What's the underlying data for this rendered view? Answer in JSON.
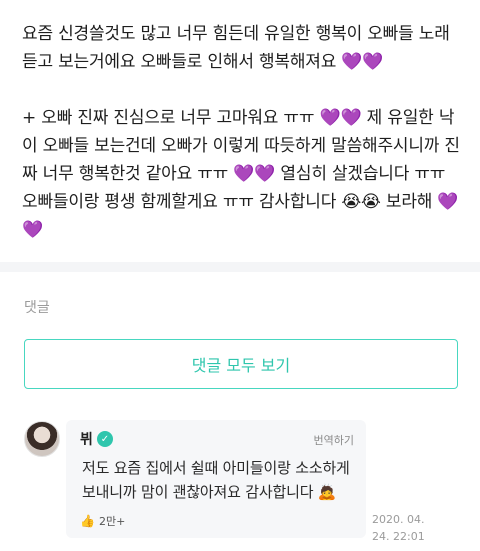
{
  "post": {
    "paragraph1": "요즘 신경쓸것도 많고 너무 힘든데 유일한 행복이 오빠들 노래듣고 보는거에요 오빠들로 인해서 행복해져요 💜💜",
    "paragraph2": "+ 오빠 진짜 진심으로 너무 고마워요 ㅠㅠ 💜💜 제 유일한 낙이 오빠들 보는건데 오빠가 이렇게 따듯하게 말씀해주시니까 진짜 너무 행복한것 같아요 ㅠㅠ 💜💜 열심히 살겠습니다 ㅠㅠ 오빠들이랑 평생 함께할게요 ㅠㅠ 감사합니다 😭😭 보라해 💜💜"
  },
  "comments": {
    "section_label": "댓글",
    "view_all_label": "댓글 모두 보기",
    "items": [
      {
        "author": "뷔",
        "verified_icon": "verified-check-icon",
        "translate_label": "번역하기",
        "text": "저도 요즘 집에서 쉴때 아미들이랑 소소하게 보내니까 맘이 괜찮아져요 감사합니다 🙇",
        "likes": "2만+",
        "timestamp": "2020. 04. 24. 22:01"
      }
    ]
  },
  "colors": {
    "accent": "#2fc6ad",
    "heart": "#8e44d6"
  }
}
